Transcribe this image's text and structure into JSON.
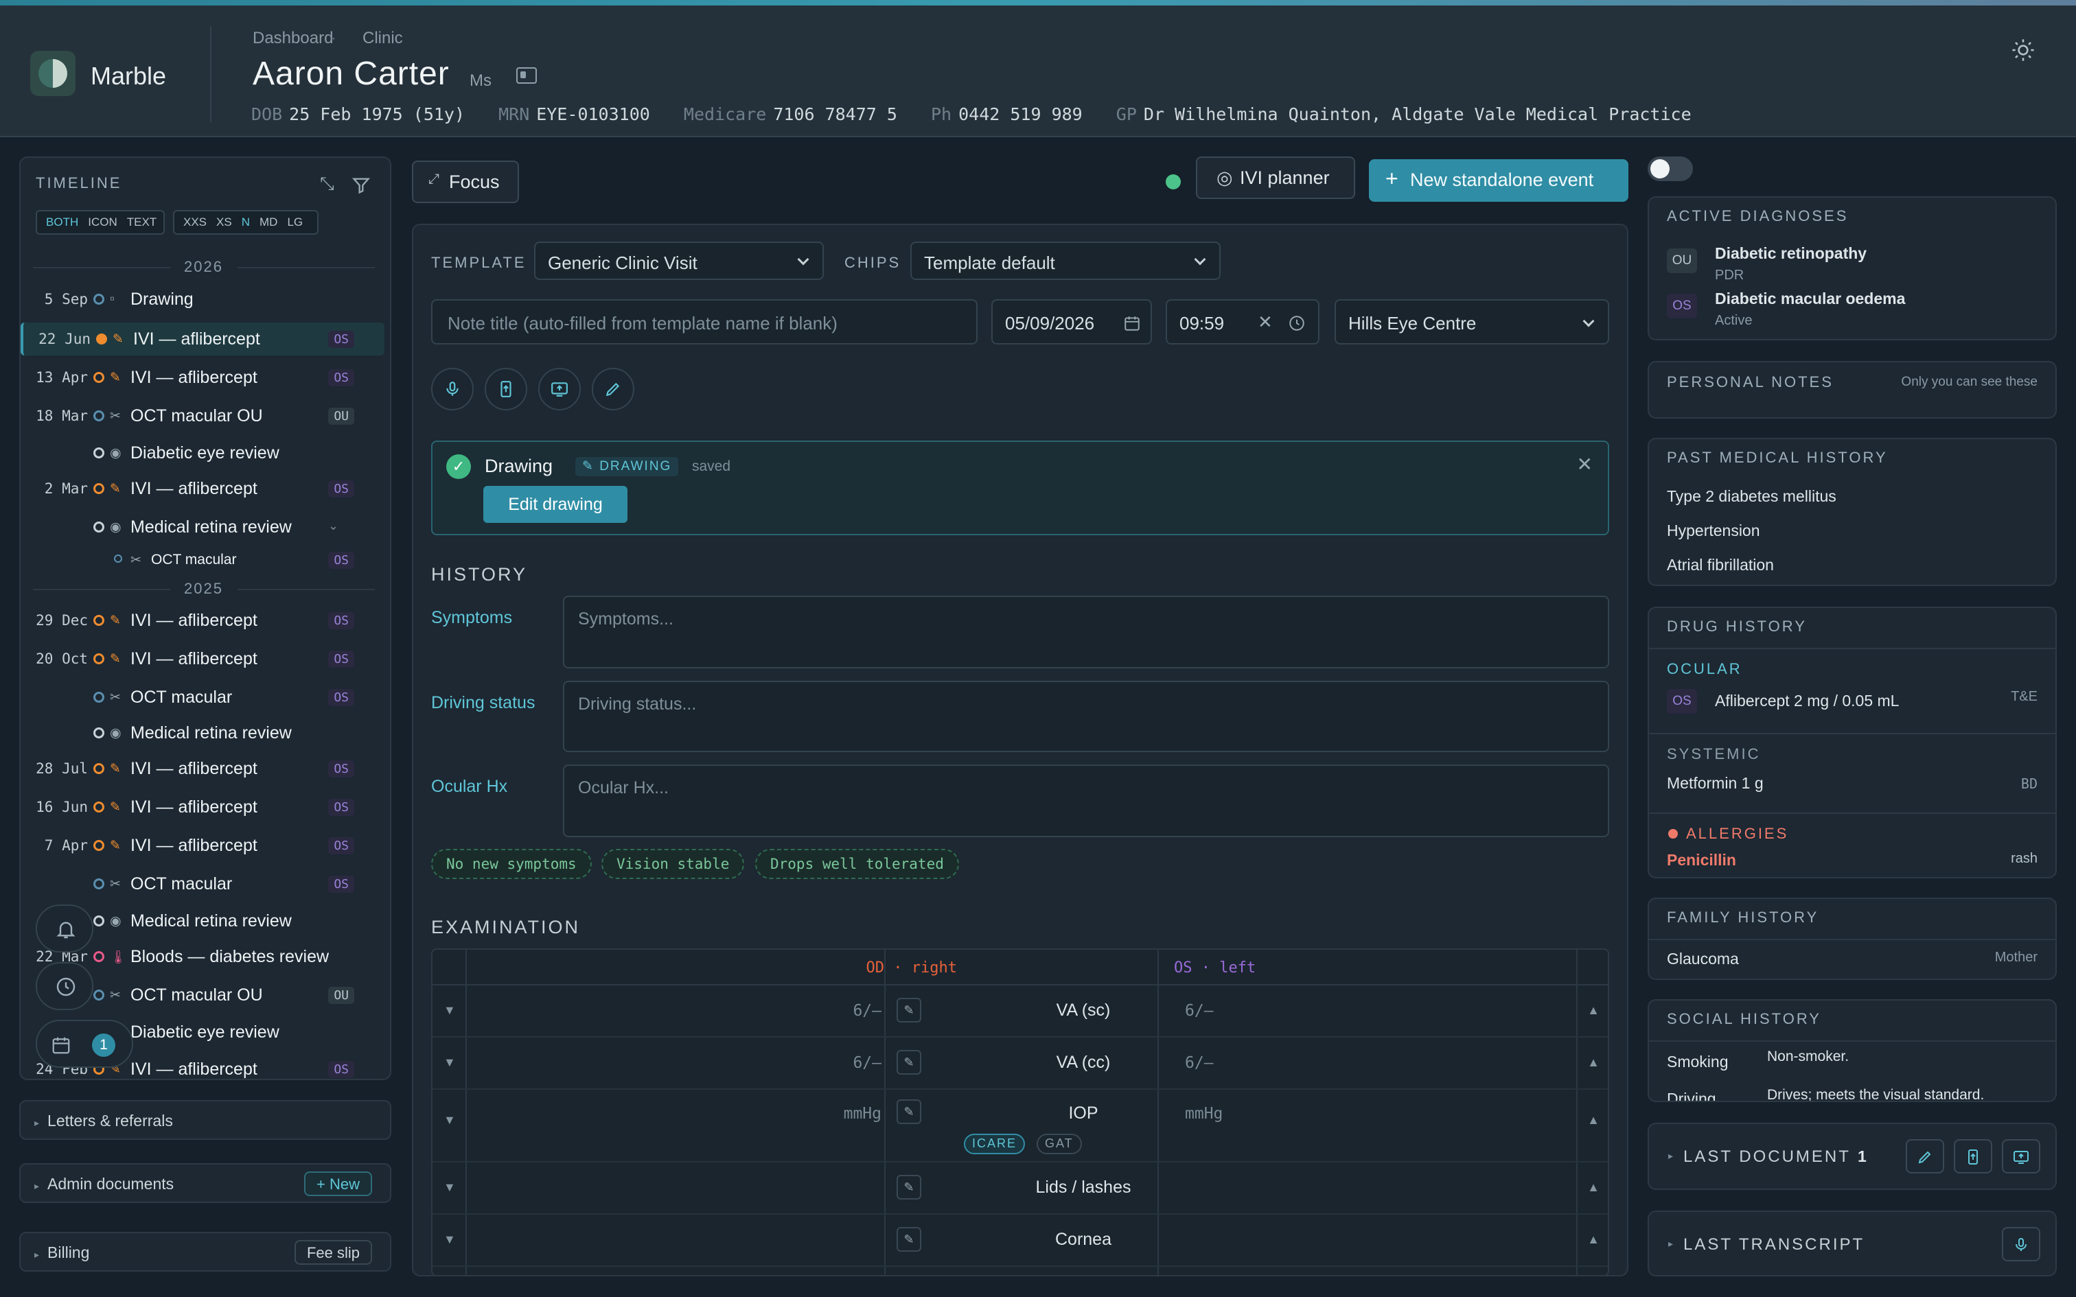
{
  "app": {
    "brand": "Marble"
  },
  "breadcrumb": [
    "Dashboard",
    "Clinic"
  ],
  "patient": {
    "name": "Aaron Carter",
    "title": "Ms",
    "meta": [
      {
        "k": "DOB",
        "v": "25 Feb 1975 (51y)"
      },
      {
        "k": "MRN",
        "v": "EYE-0103100"
      },
      {
        "k": "Medicare",
        "v": "7106 78477 5"
      },
      {
        "k": "Ph",
        "v": "0442 519 989"
      },
      {
        "k": "GP",
        "v": "Dr Wilhelmina Quainton, Aldgate Vale Medical Practice"
      }
    ]
  },
  "timeline": {
    "title": "TIMELINE",
    "view_modes": [
      "BOTH",
      "ICON",
      "TEXT"
    ],
    "sizes": [
      "XXS",
      "XS",
      "N",
      "MD",
      "LG"
    ],
    "years": [
      "2026",
      "2025"
    ],
    "rows": [
      {
        "date": "5 Sep",
        "label": "Drawing",
        "tag": ""
      },
      {
        "date": "22 Jun",
        "label": "IVI — aflibercept",
        "tag": "OS"
      },
      {
        "date": "13 Apr",
        "label": "IVI — aflibercept",
        "tag": "OS"
      },
      {
        "date": "18 Mar",
        "label": "OCT macular OU",
        "tag": "OU"
      },
      {
        "date": "",
        "label": "Diabetic eye review",
        "tag": ""
      },
      {
        "date": "2 Mar",
        "label": "IVI — aflibercept",
        "tag": "OS"
      },
      {
        "date": "",
        "label": "Medical retina review",
        "tag": ""
      },
      {
        "date": "",
        "label": "OCT macular",
        "tag": "OS"
      },
      {
        "date": "29 Dec",
        "label": "IVI — aflibercept",
        "tag": "OS"
      },
      {
        "date": "20 Oct",
        "label": "IVI — aflibercept",
        "tag": "OS"
      },
      {
        "date": "",
        "label": "OCT macular",
        "tag": "OS"
      },
      {
        "date": "",
        "label": "Medical retina review",
        "tag": ""
      },
      {
        "date": "28 Jul",
        "label": "IVI — aflibercept",
        "tag": "OS"
      },
      {
        "date": "16 Jun",
        "label": "IVI — aflibercept",
        "tag": "OS"
      },
      {
        "date": "7 Apr",
        "label": "IVI — aflibercept",
        "tag": "OS"
      },
      {
        "date": "",
        "label": "OCT macular",
        "tag": "OS"
      },
      {
        "date": "",
        "label": "Medical retina review",
        "tag": ""
      },
      {
        "date": "22 Mar",
        "label": "Bloods — diabetes review",
        "tag": ""
      },
      {
        "date": "",
        "label": "OCT macular OU",
        "tag": "OU"
      },
      {
        "date": "",
        "label": "Diabetic eye review",
        "tag": ""
      },
      {
        "date": "24 Feb",
        "label": "IVI — aflibercept",
        "tag": "OS"
      }
    ],
    "notification_count": "1"
  },
  "sidebar_sections": {
    "letters": "Letters & referrals",
    "admin": "Admin documents",
    "admin_btn": "+ New",
    "billing": "Billing",
    "billing_btn": "Fee slip"
  },
  "toolbar": {
    "focus": "Focus",
    "ivi_planner": "IVI planner",
    "new_event": "New standalone event"
  },
  "form": {
    "template_label": "TEMPLATE",
    "template_value": "Generic Clinic Visit",
    "chips_label": "CHIPS",
    "chips_value": "Template default",
    "note_title_placeholder": "Note title (auto-filled from template name if blank)",
    "date": "05/09/2026",
    "time": "09:59",
    "location": "Hills Eye Centre"
  },
  "drawing_card": {
    "title": "Drawing",
    "badge": "DRAWING",
    "status": "saved",
    "edit_btn": "Edit drawing"
  },
  "history": {
    "title": "HISTORY",
    "fields": [
      {
        "label": "Symptoms",
        "placeholder": "Symptoms..."
      },
      {
        "label": "Driving status",
        "placeholder": "Driving status..."
      },
      {
        "label": "Ocular Hx",
        "placeholder": "Ocular Hx..."
      }
    ],
    "chips": [
      "No new symptoms",
      "Vision stable",
      "Drops well tolerated"
    ]
  },
  "examination": {
    "title": "EXAMINATION",
    "od_header": "OD · right",
    "os_header": "OS · left",
    "rows": [
      {
        "name": "VA (sc)",
        "od": "6/—",
        "os": "6/—"
      },
      {
        "name": "VA (cc)",
        "od": "6/—",
        "os": "6/—"
      },
      {
        "name": "IOP",
        "od": "mmHg",
        "os": "mmHg",
        "sub": [
          "ICARE",
          "GAT"
        ]
      },
      {
        "name": "Lids / lashes",
        "od": "",
        "os": ""
      },
      {
        "name": "Cornea",
        "od": "",
        "os": ""
      }
    ]
  },
  "right": {
    "active_dx_title": "ACTIVE DIAGNOSES",
    "active_dx": [
      {
        "eye": "OU",
        "name": "Diabetic retinopathy",
        "sub": "PDR"
      },
      {
        "eye": "OS",
        "name": "Diabetic macular oedema",
        "sub": "Active"
      }
    ],
    "personal_notes_title": "PERSONAL NOTES",
    "personal_notes_hint": "Only you can see these",
    "pmh_title": "PAST MEDICAL HISTORY",
    "pmh": [
      "Type 2 diabetes mellitus",
      "Hypertension",
      "Atrial fibrillation"
    ],
    "drug_title": "DRUG HISTORY",
    "ocular_label": "OCULAR",
    "ocular_drug": {
      "eye": "OS",
      "name": "Aflibercept 2 mg / 0.05 mL",
      "freq": "T&E"
    },
    "systemic_label": "SYSTEMIC",
    "systemic_drug": {
      "name": "Metformin 1 g",
      "freq": "BD"
    },
    "allergies_label": "ALLERGIES",
    "allergy": {
      "name": "Penicillin",
      "reaction": "rash"
    },
    "family_title": "FAMILY HISTORY",
    "family": {
      "name": "Glaucoma",
      "rel": "Mother"
    },
    "social_title": "SOCIAL HISTORY",
    "social": [
      {
        "k": "Smoking",
        "v": "Non-smoker."
      },
      {
        "k": "Driving",
        "v": "Drives; meets the visual standard."
      }
    ],
    "last_document": "LAST DOCUMENT",
    "last_document_count": "1",
    "last_transcript": "LAST TRANSCRIPT"
  },
  "colors": {
    "accent": "#2f8ea5",
    "od": "#e8613a",
    "os": "#9a6ad8",
    "allergy": "#f07a6a"
  }
}
